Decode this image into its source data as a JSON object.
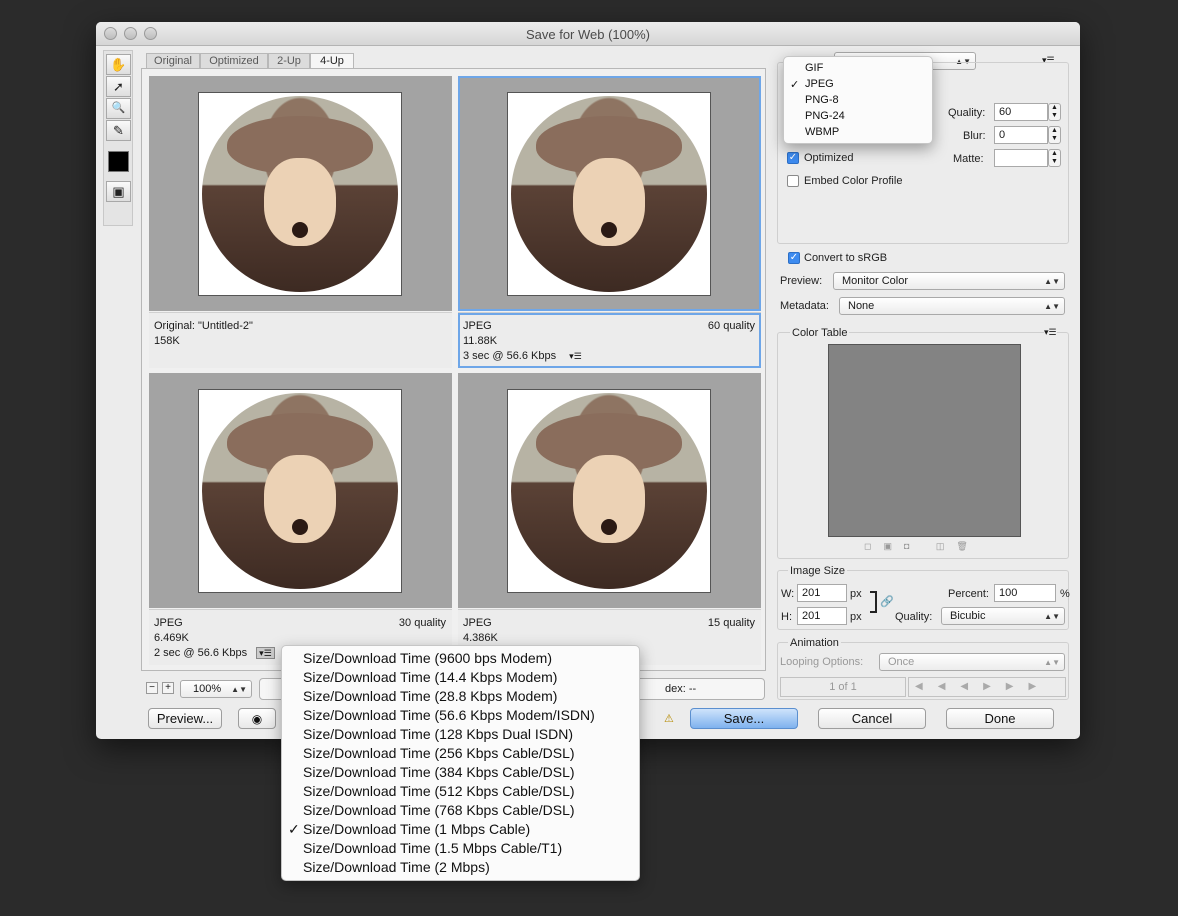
{
  "window": {
    "title": "Save for Web (100%)"
  },
  "tabs": [
    "Original",
    "Optimized",
    "2-Up",
    "4-Up"
  ],
  "tools": [
    {
      "icon": "hand-icon",
      "glyph": "✋"
    },
    {
      "icon": "slice-select-icon",
      "glyph": "➚"
    },
    {
      "icon": "zoom-icon",
      "glyph": "🔍"
    },
    {
      "icon": "eyedropper-icon",
      "glyph": "✎"
    },
    {
      "icon": "color-swatch-icon",
      "glyph": ""
    },
    {
      "icon": "slices-toggle-icon",
      "glyph": "▣"
    }
  ],
  "panes": [
    {
      "format": "Original: \"Untitled-2\"",
      "quality": "",
      "size": "158K",
      "time": ""
    },
    {
      "format": "JPEG",
      "quality": "60 quality",
      "size": "11.88K",
      "time": "3 sec @ 56.6 Kbps"
    },
    {
      "format": "JPEG",
      "quality": "30 quality",
      "size": "6.469K",
      "time": "2 sec @ 56.6 Kbps"
    },
    {
      "format": "JPEG",
      "quality": "15 quality",
      "size": "4.386K",
      "time": ""
    }
  ],
  "status": {
    "zoom": "100%",
    "index": "dex: --"
  },
  "buttons": {
    "preview": "Preview...",
    "save": "Save...",
    "cancel": "Cancel",
    "done": "Done"
  },
  "format_menu": {
    "items": [
      "GIF",
      "JPEG",
      "PNG-8",
      "PNG-24",
      "WBMP"
    ],
    "selected": "JPEG"
  },
  "settings": {
    "quality_label": "Quality:",
    "quality_value": "60",
    "blur_label": "Blur:",
    "blur_value": "0",
    "matte_label": "Matte:",
    "optimized_label": "Optimized",
    "optimized": true,
    "embed_label": "Embed Color Profile",
    "embed": false,
    "srgb_label": "Convert to sRGB",
    "srgb": true,
    "preview_label": "Preview:",
    "preview_value": "Monitor Color",
    "metadata_label": "Metadata:",
    "metadata_value": "None"
  },
  "color_table": {
    "title": "Color Table"
  },
  "image_size": {
    "title": "Image Size",
    "w_label": "W:",
    "w_value": "201",
    "h_label": "H:",
    "h_value": "201",
    "unit": "px",
    "percent_label": "Percent:",
    "percent_value": "100",
    "percent_unit": "%",
    "quality_label": "Quality:",
    "quality_value": "Bicubic"
  },
  "animation": {
    "title": "Animation",
    "looping_label": "Looping Options:",
    "looping_value": "Once",
    "frame": "1 of 1"
  },
  "download_menu": {
    "items": [
      "Size/Download Time (9600 bps Modem)",
      "Size/Download Time (14.4 Kbps Modem)",
      "Size/Download Time (28.8 Kbps Modem)",
      "Size/Download Time (56.6 Kbps Modem/ISDN)",
      "Size/Download Time (128 Kbps Dual ISDN)",
      "Size/Download Time (256 Kbps Cable/DSL)",
      "Size/Download Time (384 Kbps Cable/DSL)",
      "Size/Download Time (512 Kbps Cable/DSL)",
      "Size/Download Time (768 Kbps Cable/DSL)",
      "Size/Download Time (1 Mbps Cable)",
      "Size/Download Time (1.5 Mbps Cable/T1)",
      "Size/Download Time (2 Mbps)"
    ],
    "selected_index": 9,
    "check": "✓"
  },
  "colors": {
    "accent": "#3d8bf0",
    "canvas_bg": "#a3a3a3",
    "color_table_bg": "#838383"
  }
}
